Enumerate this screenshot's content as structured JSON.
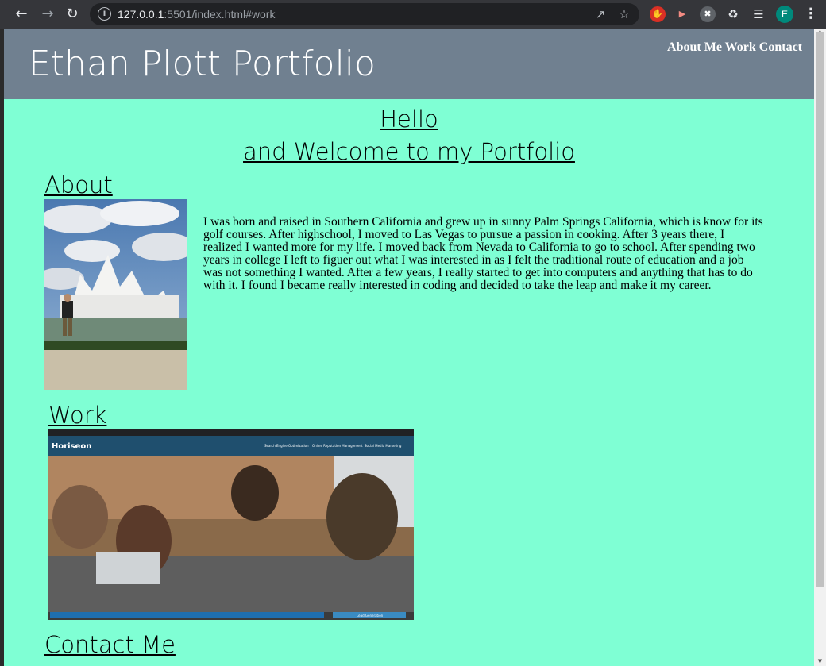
{
  "browser": {
    "url_host": "127.0.0.1",
    "url_rest": ":5501/index.html#work",
    "avatar_letter": "E"
  },
  "header": {
    "title": "Ethan Plott Portfolio",
    "nav": [
      "About Me",
      "Work",
      "Contact"
    ]
  },
  "hero": {
    "line1": "Hello",
    "line2": "and Welcome to my Portfolio"
  },
  "about": {
    "heading": "About",
    "text": "I was born and raised in Southern California and grew up in sunny Palm Springs California, which is know for its golf courses. After highschool, I moved to Las Vegas to pursue a passion in cooking. After 3 years there, I realized I wanted more for my life. I moved back from Nevada to California to go to school. After spending two years in college I left to figuer out what I was interested in as I felt the traditional route of education and a job was not something I wanted. After a few years, I really started to get into computers and anything that has to do with it. I found I became really interested in coding and decided to take the leap and make it my career."
  },
  "work": {
    "heading": "Work",
    "project": {
      "brand": "Horiseon",
      "nav": [
        "Search Engine Optimization",
        "Online Reputation Management",
        "Social Media Marketing"
      ],
      "button": "Lead Generation"
    }
  },
  "contact": {
    "heading": "Contact Me"
  },
  "colors": {
    "page_bg": "#7fffd4",
    "header_bg": "#708090"
  }
}
